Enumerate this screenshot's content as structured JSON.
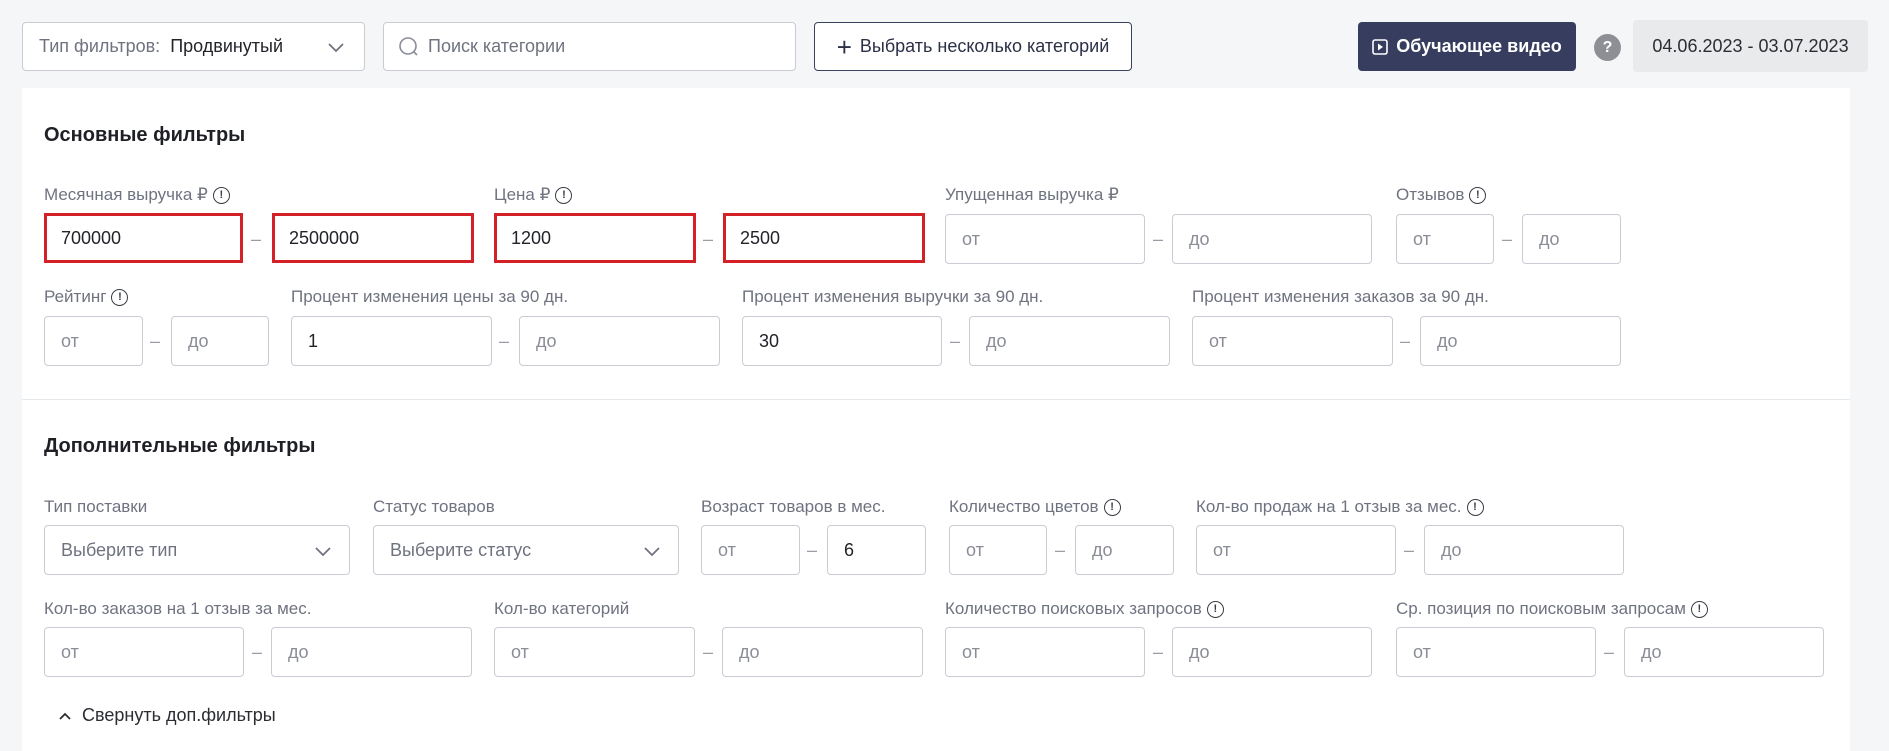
{
  "topbar": {
    "filter_type_label": "Тип фильтров:",
    "filter_type_value": "Продвинутый",
    "search_placeholder": "Поиск категории",
    "multi_select_label": "Выбрать несколько категорий",
    "video_label": "Обучающее видео",
    "help_label": "?",
    "date_range": "04.06.2023 - 03.07.2023"
  },
  "main_filters": {
    "title": "Основные фильтры",
    "monthly_revenue": {
      "label": "Месячная выручка ₽",
      "from": "700000",
      "to": "2500000"
    },
    "price": {
      "label": "Цена ₽",
      "from": "1200",
      "to": "2500"
    },
    "lost_revenue": {
      "label": "Упущенная выручка ₽",
      "from_ph": "от",
      "to_ph": "до"
    },
    "reviews": {
      "label": "Отзывов",
      "from_ph": "от",
      "to_ph": "до"
    },
    "rating": {
      "label": "Рейтинг",
      "from_ph": "от",
      "to_ph": "до"
    },
    "price_change": {
      "label": "Процент изменения цены за 90 дн.",
      "from": "1",
      "to_ph": "до"
    },
    "revenue_change": {
      "label": "Процент изменения выручки за 90 дн.",
      "from": "30",
      "to_ph": "до"
    },
    "orders_change": {
      "label": "Процент изменения заказов за 90 дн.",
      "from_ph": "от",
      "to_ph": "до"
    }
  },
  "extra_filters": {
    "title": "Дополнительные фильтры",
    "supply_type": {
      "label": "Тип поставки",
      "placeholder": "Выберите тип"
    },
    "product_status": {
      "label": "Статус товаров",
      "placeholder": "Выберите статус"
    },
    "product_age": {
      "label": "Возраст товаров в мес.",
      "from_ph": "от",
      "to": "6"
    },
    "colors_count": {
      "label": "Количество цветов",
      "from_ph": "от",
      "to_ph": "до"
    },
    "sales_per_review": {
      "label": "Кол-во продаж на 1 отзыв за мес.",
      "from_ph": "от",
      "to_ph": "до"
    },
    "orders_per_review": {
      "label": "Кол-во заказов на 1 отзыв за мес.",
      "from_ph": "от",
      "to_ph": "до"
    },
    "categories_count": {
      "label": "Кол-во категорий",
      "from_ph": "от",
      "to_ph": "до"
    },
    "search_queries": {
      "label": "Количество поисковых запросов",
      "from_ph": "от",
      "to_ph": "до"
    },
    "avg_position": {
      "label": "Ср. позиция по поисковым запросам",
      "from_ph": "от",
      "to_ph": "до"
    },
    "collapse_label": "Свернуть доп.фильтры"
  },
  "dash": "–",
  "colors": {
    "highlight": "#d42128",
    "accent": "#363d5e"
  }
}
